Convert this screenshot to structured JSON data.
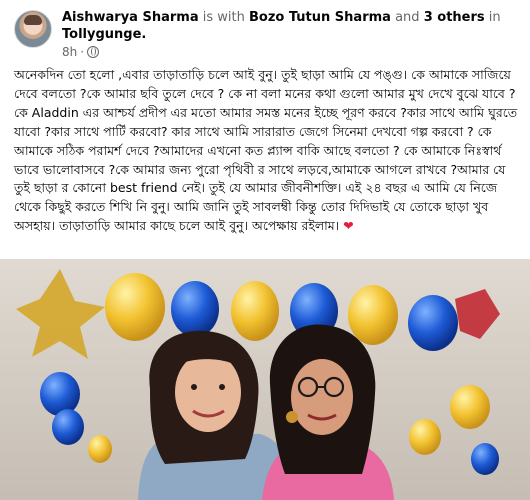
{
  "post": {
    "author": "Aishwarya Sharma",
    "with_word": "is with",
    "tagged": "Bozo Tutun Sharma",
    "and_word": "and",
    "others": "3 others",
    "in_word": "in",
    "location": "Tollygunge.",
    "time": "8h",
    "dot": "·",
    "text": "অনেকদিন তো হলো ,এবার তাড়াতাড়ি চলে আই বুনু। তুই ছাড়া আমি যে পঙ্গু। কে আমাকে সাজিয়ে দেবে বলতো ?কে আমার ছবি তুলে দেবে ? কে না বলা মনের কথা গুলো আমার মুখ দেখে বুঝে যাবে ? কে Aladdin এর আশ্চর্য প্রদীপ এর মতো আমার সমস্ত মনের ইচ্ছে পূরণ করবে ?কার সাথে আমি ঘুরতে যাবো ?কার সাথে পার্টি করবো? কার সাথে আমি সারারাত জেগে সিনেমা দেখবো গল্প করবো ? কে আমাকে সঠিক পরামর্শ দেবে ?আমাদের এখনো কত প্ল্যান্স বাকি আছে বলতো ? কে আমাকে নিঃস্বার্থ ভাবে ভালোবাসবে ?কে আমার জন্য পুরো পৃথিবী র সাথে লড়বে,আমাকে আগলে রাখবে ?আমার যে তুই ছাড়া র কোনো best friend নেই। তুই যে আমার জীবনীশক্তি। এই ২৪ বছর এ আমি যে নিজে থেকে কিছুই করতে শিখি নি বুনু। আমি জানি তুই সাবলম্বী কিন্তু তোর দিদিভাই যে তোকে ছাড়া খুব অসহায়। তাড়াতাড়ি আমার কাছে চলে আই বুনু। অপেক্ষায় রইলাম।",
    "heart": "❤"
  },
  "colors": {
    "text": "#050505",
    "secondary": "#65676b",
    "heart": "#e41e3f",
    "balloon_yellow": "#f2c230",
    "balloon_blue": "#1e5bd6"
  },
  "icons": [
    "avatar",
    "globe-icon",
    "heart-emoji"
  ]
}
